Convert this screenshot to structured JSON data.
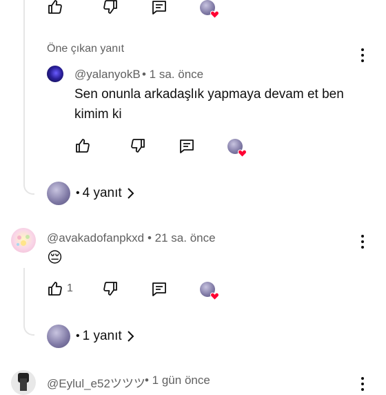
{
  "colors": {
    "text": "#0f0f0f",
    "secondary": "#606060",
    "heart": "#ff0033",
    "thread_line": "#e5e5e5"
  },
  "icons": [
    "like-icon",
    "dislike-icon",
    "reply-comment-icon",
    "creator-heart-icon",
    "chevron-right-icon",
    "more-vert-icon"
  ],
  "featured_reply": {
    "section_label": "Öne çıkan yanıt",
    "author": "@yalanyokB",
    "time": "• 1 sa. önce",
    "text": "Sen onunla arkadaşlık yapmaya devam et ben kimim ki"
  },
  "thread1": {
    "replies_label": "4 yanıt"
  },
  "comment2": {
    "author": "@avakadofanpkxd",
    "time": "• 21 sa. önce",
    "emoji": "😔",
    "like_count": "1",
    "replies_label": "1 yanıt"
  },
  "comment3": {
    "author": "@Eylul_e52ツツツ",
    "time": "• 1 gün önce"
  },
  "dot": "•"
}
